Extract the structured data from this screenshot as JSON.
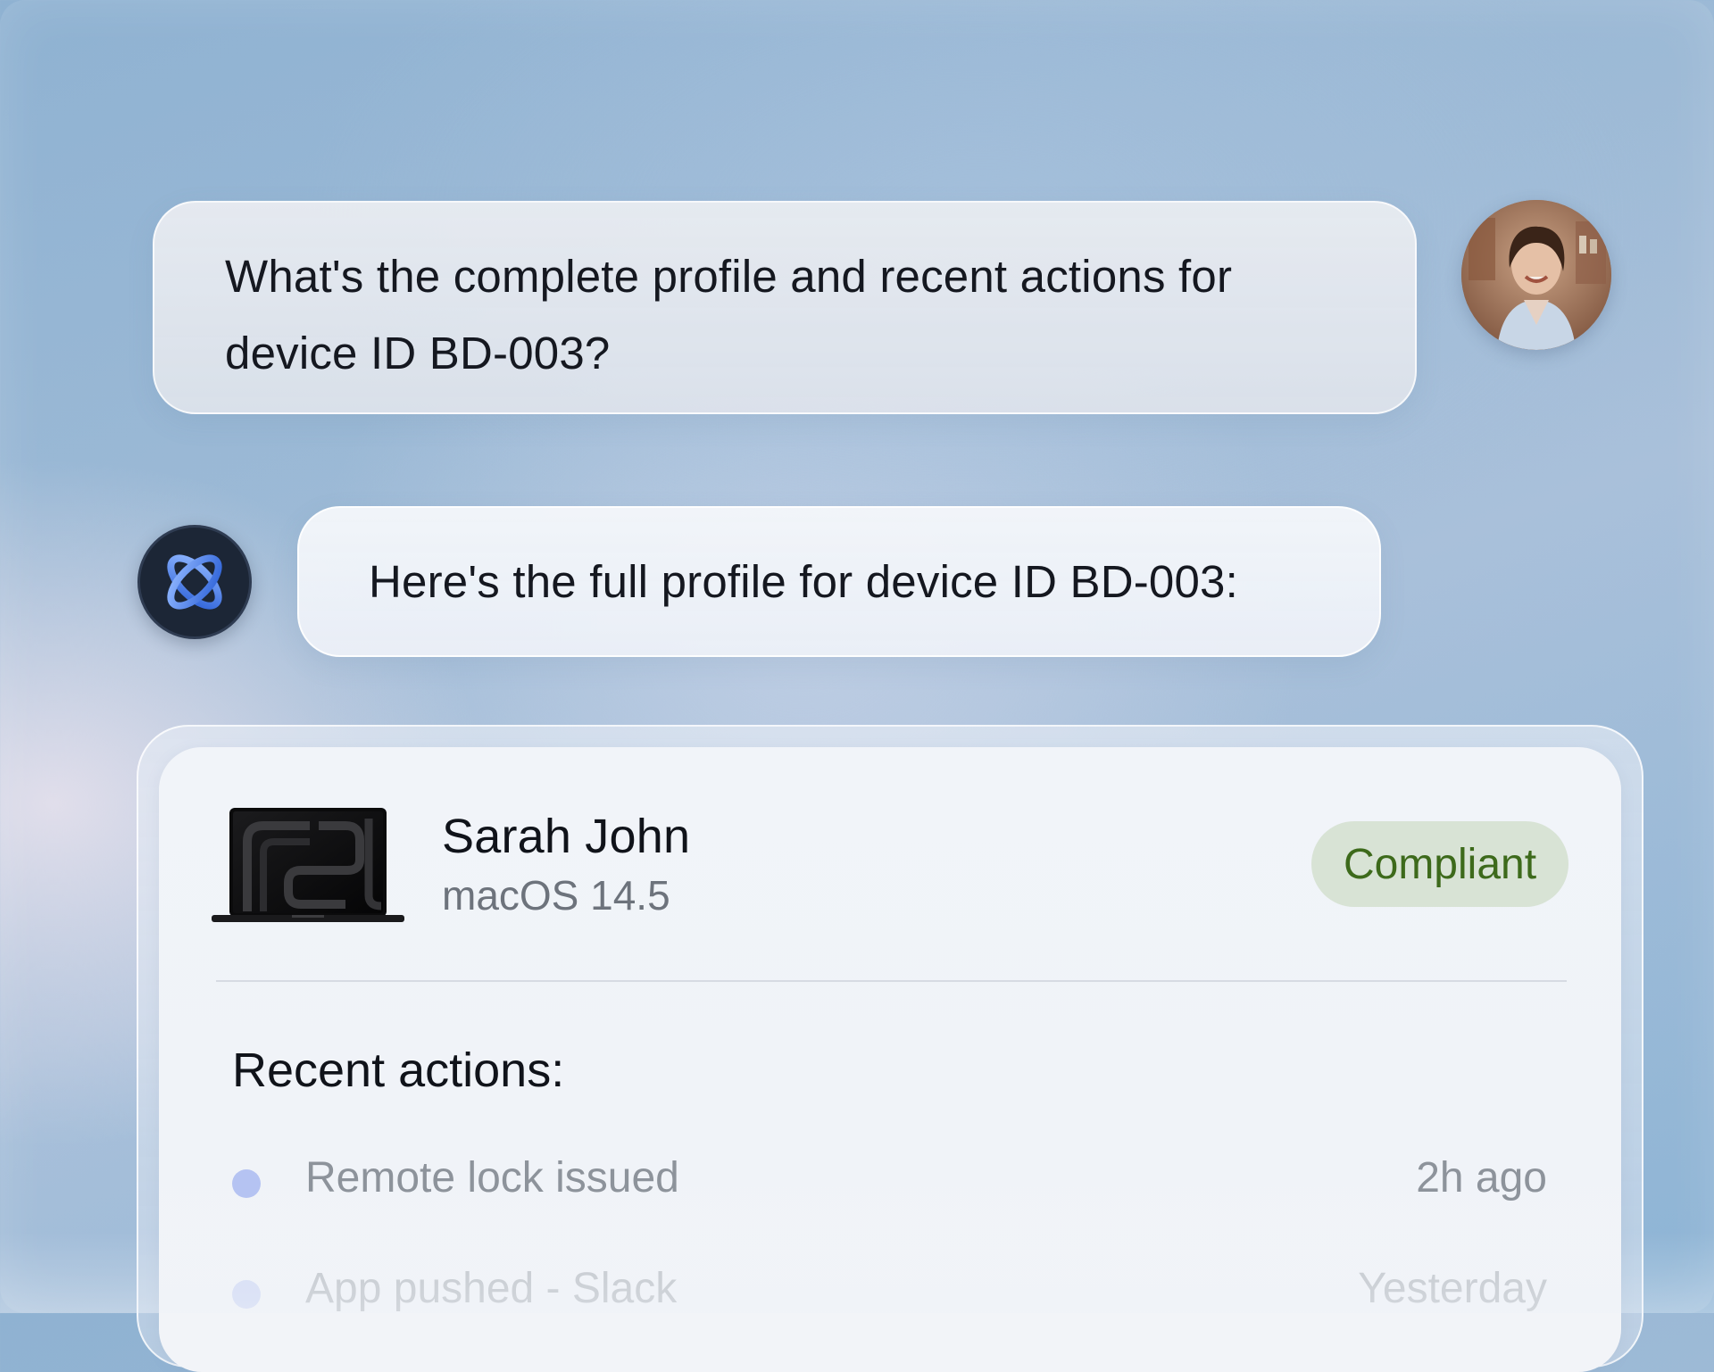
{
  "conversation": {
    "user_message": {
      "line1": "What's the complete profile and recent actions for",
      "line2": "device ID BD-003?",
      "avatar_icon": "user-avatar-photo"
    },
    "assistant_message": {
      "text": "Here's the full profile for device ID BD-003:",
      "logo_icon": "assistant-orbit-logo-icon"
    }
  },
  "device_card": {
    "owner": "Sarah John",
    "os": "macOS 14.5",
    "status": "Compliant",
    "device_image_icon": "macbook-laptop-icon",
    "recent_actions_title": "Recent actions:",
    "actions": [
      {
        "label": "Remote lock issued",
        "time": "2h ago"
      },
      {
        "label": "App pushed - Slack",
        "time": "Yesterday"
      }
    ]
  },
  "colors": {
    "status_badge_bg": "#d8e3d5",
    "status_badge_text": "#3d6a1b",
    "action_dot": "#b5c3f2",
    "assistant_logo_bg": "#1c2636",
    "assistant_logo_accent": "#3f7de6"
  }
}
